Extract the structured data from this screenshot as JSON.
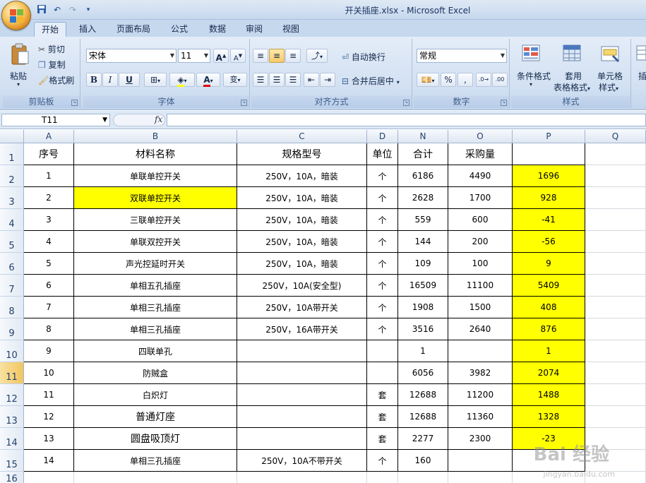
{
  "window": {
    "title": "开关插座.xlsx - Microsoft Excel",
    "qat_icons": [
      "save-icon",
      "undo-icon",
      "redo-icon",
      "customize-icon"
    ]
  },
  "tabs": [
    {
      "label": "开始",
      "active": true
    },
    {
      "label": "插入"
    },
    {
      "label": "页面布局"
    },
    {
      "label": "公式"
    },
    {
      "label": "数据"
    },
    {
      "label": "审阅"
    },
    {
      "label": "视图"
    }
  ],
  "ribbon": {
    "clipboard": {
      "label": "剪贴板",
      "paste": "粘贴",
      "cut": "剪切",
      "copy": "复制",
      "format_painter": "格式刷"
    },
    "font": {
      "label": "字体",
      "font_name": "宋体",
      "font_size": "11",
      "bold": "B",
      "italic": "I",
      "underline": "U",
      "grow": "A",
      "shrink": "A",
      "font_color_letter": "A",
      "phonetic": "wén"
    },
    "alignment": {
      "label": "对齐方式",
      "wrap": "自动换行",
      "merge": "合并后居中"
    },
    "number": {
      "label": "数字",
      "format": "常规",
      "percent": "%",
      "comma": ","
    },
    "styles": {
      "label": "样式",
      "conditional": "条件格式",
      "table_line1": "套用",
      "table_line2": "表格格式",
      "cell_line1": "单元格",
      "cell_line2": "样式"
    },
    "cells": {
      "insert": "插"
    }
  },
  "formula_bar": {
    "name_box": "T11",
    "fx": "fx",
    "value": ""
  },
  "columns": [
    "A",
    "B",
    "C",
    "D",
    "N",
    "O",
    "P",
    "Q"
  ],
  "selected_column": "",
  "selected_row": "11",
  "rows": [
    "1",
    "2",
    "3",
    "4",
    "5",
    "6",
    "7",
    "8",
    "9",
    "10",
    "11",
    "12",
    "13",
    "14",
    "15",
    "16"
  ],
  "table": {
    "header": [
      "序号",
      "材料名称",
      "规格型号",
      "单位",
      "合计",
      "采购量",
      ""
    ],
    "data": [
      [
        "1",
        "单联单控开关",
        "250V，10A，暗装",
        "个",
        "6186",
        "4490",
        "1696"
      ],
      [
        "2",
        "双联单控开关",
        "250V，10A，暗装",
        "个",
        "2628",
        "1700",
        "928"
      ],
      [
        "3",
        "三联单控开关",
        "250V，10A，暗装",
        "个",
        "559",
        "600",
        "-41"
      ],
      [
        "4",
        "单联双控开关",
        "250V，10A，暗装",
        "个",
        "144",
        "200",
        "-56"
      ],
      [
        "5",
        "声光控延时开关",
        "250V，10A，暗装",
        "个",
        "109",
        "100",
        "9"
      ],
      [
        "6",
        "单相五孔插座",
        "250V，10A(安全型)",
        "个",
        "16509",
        "11100",
        "5409"
      ],
      [
        "7",
        "单相三孔插座",
        "250V，10A带开关",
        "个",
        "1908",
        "1500",
        "408"
      ],
      [
        "8",
        "单相三孔插座",
        "250V，16A带开关",
        "个",
        "3516",
        "2640",
        "876"
      ],
      [
        "9",
        "四联单孔",
        "",
        "",
        "1",
        "",
        "1"
      ],
      [
        "10",
        "防贼盒",
        "",
        "",
        "6056",
        "3982",
        "2074"
      ],
      [
        "11",
        "白炽灯",
        "",
        "套",
        "12688",
        "11200",
        "1488"
      ],
      [
        "12",
        "普通灯座",
        "",
        "套",
        "12688",
        "11360",
        "1328"
      ],
      [
        "13",
        "圆盘吸顶灯",
        "",
        "套",
        "2277",
        "2300",
        "-23"
      ],
      [
        "14",
        "单相三孔插座",
        "250V，10A不带开关",
        "个",
        "160",
        "",
        ""
      ]
    ],
    "highlight_color": "#ffff00"
  },
  "watermark": {
    "brand": "Bai 经验",
    "url": "jingyan.baidu.com"
  }
}
